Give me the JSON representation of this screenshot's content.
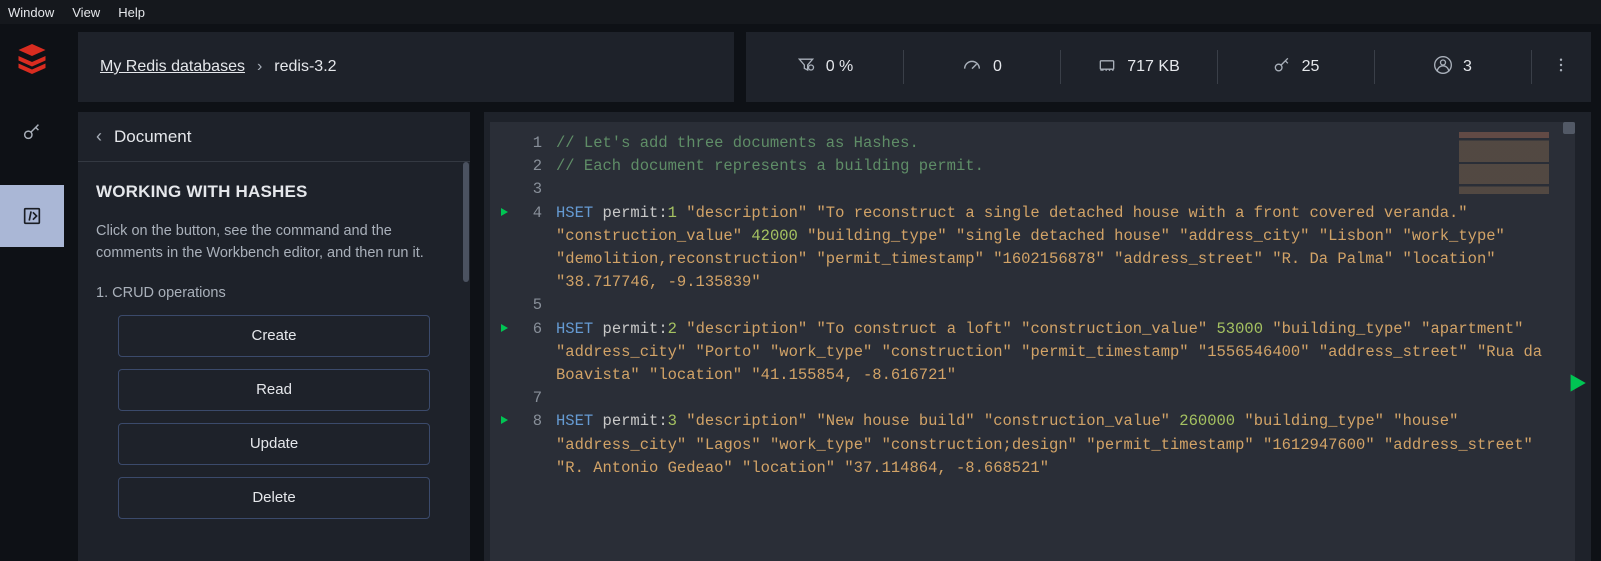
{
  "menubar": {
    "items": [
      "Window",
      "View",
      "Help"
    ]
  },
  "breadcrumb": {
    "root": "My Redis databases",
    "current": "redis-3.2"
  },
  "stats": {
    "cpu": "0 %",
    "ops": "0",
    "memory": "717 KB",
    "keys": "25",
    "clients": "3"
  },
  "tutorial": {
    "back_label": "Document",
    "title": "WORKING WITH HASHES",
    "body": "Click on the button, see the command and the comments in the Workbench editor, and then run it.",
    "section": "1. CRUD operations",
    "buttons": {
      "create": "Create",
      "read": "Read",
      "update": "Update",
      "delete": "Delete"
    }
  },
  "editor": {
    "lines": [
      {
        "n": 1,
        "play": false,
        "tokens": [
          {
            "t": "// Let's add three documents as Hashes.",
            "c": "c-c"
          }
        ]
      },
      {
        "n": 2,
        "play": false,
        "tokens": [
          {
            "t": "// Each document represents a building permit.",
            "c": "c-c"
          }
        ]
      },
      {
        "n": 3,
        "play": false,
        "tokens": []
      },
      {
        "n": 4,
        "play": true,
        "tokens": [
          {
            "t": "HSET",
            "c": "c-k"
          },
          {
            "t": " permit:",
            "c": ""
          },
          {
            "t": "1",
            "c": "c-n"
          },
          {
            "t": " ",
            "c": ""
          },
          {
            "t": "\"description\"",
            "c": "c-s"
          },
          {
            "t": " ",
            "c": ""
          },
          {
            "t": "\"To reconstruct a single detached house with a front covered veranda.\"",
            "c": "c-s"
          },
          {
            "t": " ",
            "c": ""
          },
          {
            "t": "\"construction_value\"",
            "c": "c-s"
          },
          {
            "t": " ",
            "c": ""
          },
          {
            "t": "42000",
            "c": "c-n"
          },
          {
            "t": " ",
            "c": ""
          },
          {
            "t": "\"building_type\"",
            "c": "c-s"
          },
          {
            "t": " ",
            "c": ""
          },
          {
            "t": "\"single detached house\"",
            "c": "c-s"
          },
          {
            "t": " ",
            "c": ""
          },
          {
            "t": "\"address_city\"",
            "c": "c-s"
          },
          {
            "t": " ",
            "c": ""
          },
          {
            "t": "\"Lisbon\"",
            "c": "c-s"
          },
          {
            "t": " ",
            "c": ""
          },
          {
            "t": "\"work_type\"",
            "c": "c-s"
          },
          {
            "t": " ",
            "c": ""
          },
          {
            "t": "\"demolition,reconstruction\"",
            "c": "c-s"
          },
          {
            "t": " ",
            "c": ""
          },
          {
            "t": "\"permit_timestamp\"",
            "c": "c-s"
          },
          {
            "t": " ",
            "c": ""
          },
          {
            "t": "\"1602156878\"",
            "c": "c-s"
          },
          {
            "t": " ",
            "c": ""
          },
          {
            "t": "\"address_street\"",
            "c": "c-s"
          },
          {
            "t": " ",
            "c": ""
          },
          {
            "t": "\"R. Da Palma\"",
            "c": "c-s"
          },
          {
            "t": " ",
            "c": ""
          },
          {
            "t": "\"location\"",
            "c": "c-s"
          },
          {
            "t": " ",
            "c": ""
          },
          {
            "t": "\"38.717746, -9.135839\"",
            "c": "c-s"
          }
        ]
      },
      {
        "n": 5,
        "play": false,
        "tokens": []
      },
      {
        "n": 6,
        "play": true,
        "tokens": [
          {
            "t": "HSET",
            "c": "c-k"
          },
          {
            "t": " permit:",
            "c": ""
          },
          {
            "t": "2",
            "c": "c-n"
          },
          {
            "t": " ",
            "c": ""
          },
          {
            "t": "\"description\"",
            "c": "c-s"
          },
          {
            "t": " ",
            "c": ""
          },
          {
            "t": "\"To construct a loft\"",
            "c": "c-s"
          },
          {
            "t": " ",
            "c": ""
          },
          {
            "t": "\"construction_value\"",
            "c": "c-s"
          },
          {
            "t": " ",
            "c": ""
          },
          {
            "t": "53000",
            "c": "c-n"
          },
          {
            "t": " ",
            "c": ""
          },
          {
            "t": "\"building_type\"",
            "c": "c-s"
          },
          {
            "t": " ",
            "c": ""
          },
          {
            "t": "\"apartment\"",
            "c": "c-s"
          },
          {
            "t": " ",
            "c": ""
          },
          {
            "t": "\"address_city\"",
            "c": "c-s"
          },
          {
            "t": " ",
            "c": ""
          },
          {
            "t": "\"Porto\"",
            "c": "c-s"
          },
          {
            "t": " ",
            "c": ""
          },
          {
            "t": "\"work_type\"",
            "c": "c-s"
          },
          {
            "t": " ",
            "c": ""
          },
          {
            "t": "\"construction\"",
            "c": "c-s"
          },
          {
            "t": " ",
            "c": ""
          },
          {
            "t": "\"permit_timestamp\"",
            "c": "c-s"
          },
          {
            "t": " ",
            "c": ""
          },
          {
            "t": "\"1556546400\"",
            "c": "c-s"
          },
          {
            "t": " ",
            "c": ""
          },
          {
            "t": "\"address_street\"",
            "c": "c-s"
          },
          {
            "t": " ",
            "c": ""
          },
          {
            "t": "\"Rua da Boavista\"",
            "c": "c-s"
          },
          {
            "t": " ",
            "c": ""
          },
          {
            "t": "\"location\"",
            "c": "c-s"
          },
          {
            "t": " ",
            "c": ""
          },
          {
            "t": "\"41.155854, -8.616721\"",
            "c": "c-s"
          }
        ]
      },
      {
        "n": 7,
        "play": false,
        "tokens": []
      },
      {
        "n": 8,
        "play": true,
        "tokens": [
          {
            "t": "HSET",
            "c": "c-k"
          },
          {
            "t": " permit:",
            "c": ""
          },
          {
            "t": "3",
            "c": "c-n"
          },
          {
            "t": " ",
            "c": ""
          },
          {
            "t": "\"description\"",
            "c": "c-s"
          },
          {
            "t": " ",
            "c": ""
          },
          {
            "t": "\"New house build\"",
            "c": "c-s"
          },
          {
            "t": " ",
            "c": ""
          },
          {
            "t": "\"construction_value\"",
            "c": "c-s"
          },
          {
            "t": " ",
            "c": ""
          },
          {
            "t": "260000",
            "c": "c-n"
          },
          {
            "t": " ",
            "c": ""
          },
          {
            "t": "\"building_type\"",
            "c": "c-s"
          },
          {
            "t": " ",
            "c": ""
          },
          {
            "t": "\"house\"",
            "c": "c-s"
          },
          {
            "t": " ",
            "c": ""
          },
          {
            "t": "\"address_city\"",
            "c": "c-s"
          },
          {
            "t": " ",
            "c": ""
          },
          {
            "t": "\"Lagos\"",
            "c": "c-s"
          },
          {
            "t": " ",
            "c": ""
          },
          {
            "t": "\"work_type\"",
            "c": "c-s"
          },
          {
            "t": " ",
            "c": ""
          },
          {
            "t": "\"construction;design\"",
            "c": "c-s"
          },
          {
            "t": " ",
            "c": ""
          },
          {
            "t": "\"permit_timestamp\"",
            "c": "c-s"
          },
          {
            "t": " ",
            "c": ""
          },
          {
            "t": "\"1612947600\"",
            "c": "c-s"
          },
          {
            "t": " ",
            "c": ""
          },
          {
            "t": "\"address_street\"",
            "c": "c-s"
          },
          {
            "t": " ",
            "c": ""
          },
          {
            "t": "\"R. Antonio Gedeao\"",
            "c": "c-s"
          },
          {
            "t": " ",
            "c": ""
          },
          {
            "t": "\"location\"",
            "c": "c-s"
          },
          {
            "t": " ",
            "c": ""
          },
          {
            "t": "\"37.114864, -8.668521\"",
            "c": "c-s"
          }
        ]
      }
    ]
  }
}
